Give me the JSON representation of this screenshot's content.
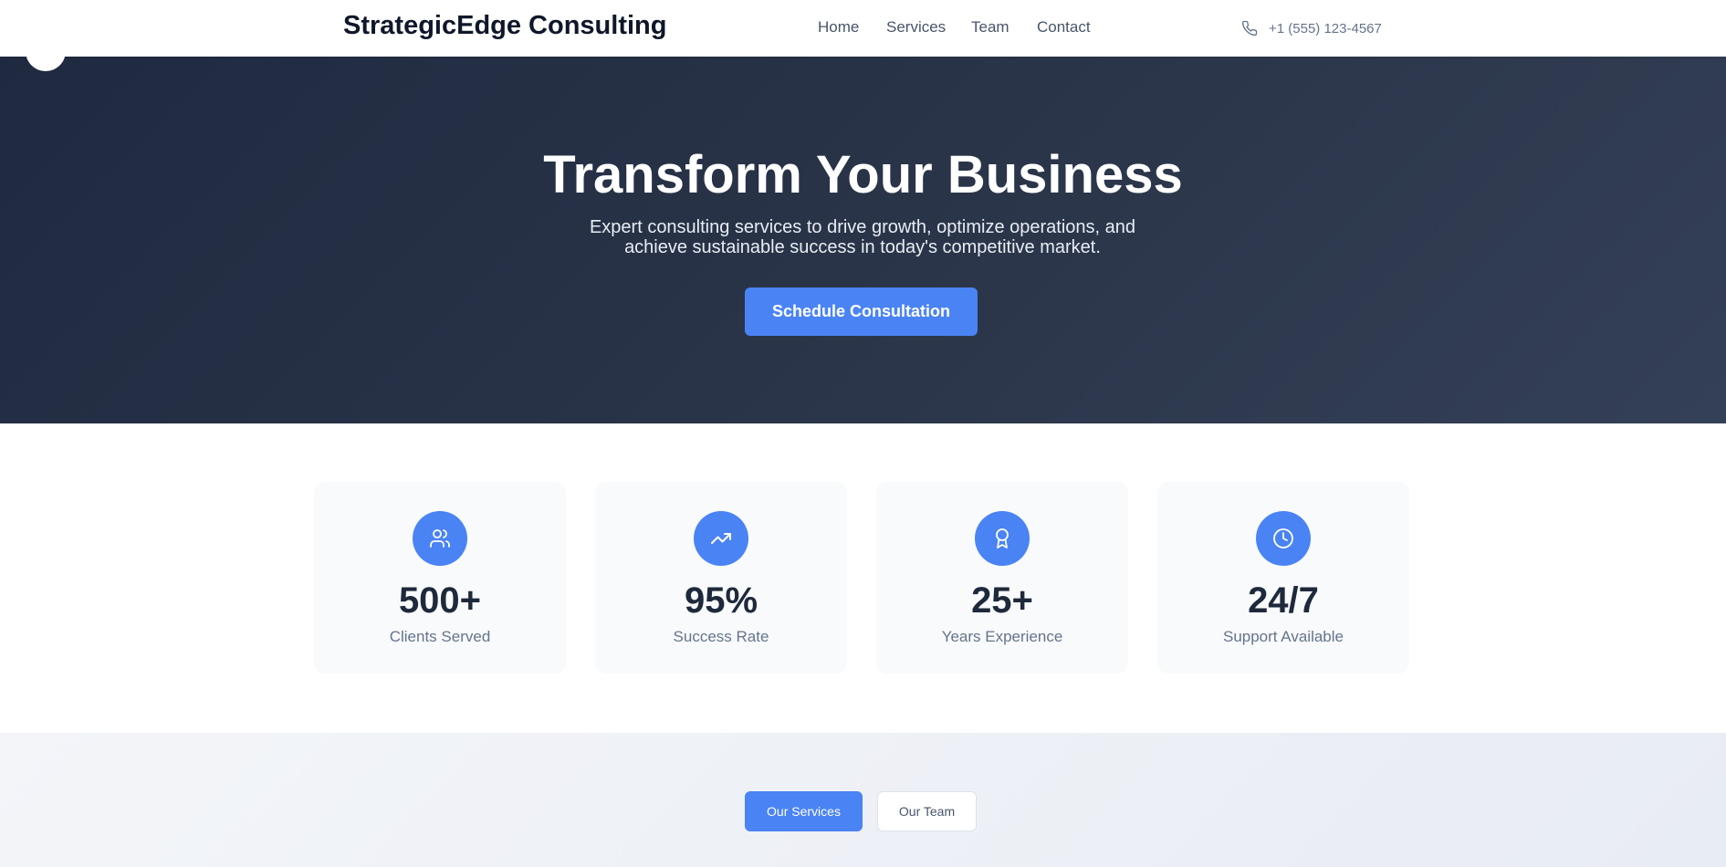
{
  "header": {
    "brand": "StrategicEdge Consulting",
    "nav": [
      {
        "label": "Home"
      },
      {
        "label": "Services"
      },
      {
        "label": "Team"
      },
      {
        "label": "Contact"
      }
    ],
    "phone": {
      "icon": "phone-icon",
      "text": "+1 (555) 123-4567"
    }
  },
  "hero": {
    "title": "Transform Your Business",
    "subtitle": "Expert consulting services to drive growth, optimize operations, and achieve sustainable success in today's competitive market.",
    "cta_label": "Schedule Consultation"
  },
  "stats": [
    {
      "icon": "users-icon",
      "value": "500+",
      "label": "Clients Served"
    },
    {
      "icon": "trending-up-icon",
      "value": "95%",
      "label": "Success Rate"
    },
    {
      "icon": "award-icon",
      "value": "25+",
      "label": "Years Experience"
    },
    {
      "icon": "clock-icon",
      "value": "24/7",
      "label": "Support Available"
    }
  ],
  "tabs": [
    {
      "label": "Our Services",
      "active": true
    },
    {
      "label": "Our Team",
      "active": false
    }
  ],
  "colors": {
    "accent": "#4a83f4",
    "hero_bg": "#2a3448",
    "text_dark": "#1e293b",
    "text_muted": "#64748b"
  }
}
